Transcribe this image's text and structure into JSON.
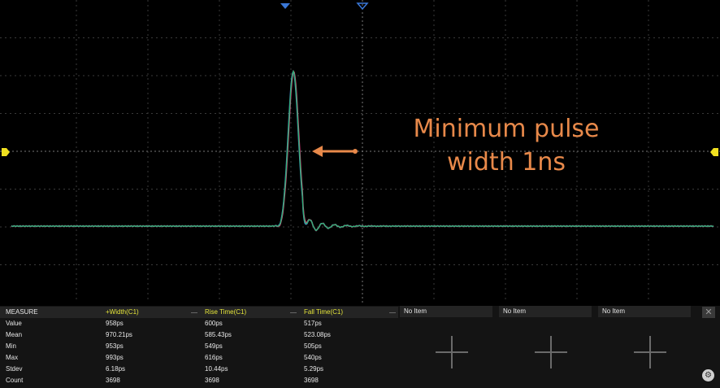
{
  "annotation": {
    "line1": "Minimum pulse",
    "line2": "width 1ns"
  },
  "measure": {
    "header": [
      "MEASURE",
      "+Width(C1)",
      "Rise Time(C1)",
      "Fall Time(C1)"
    ],
    "rows": [
      [
        "Value",
        "958ps",
        "600ps",
        "517ps"
      ],
      [
        "Mean",
        "970.21ps",
        "585.43ps",
        "523.08ps"
      ],
      [
        "Min",
        "953ps",
        "549ps",
        "505ps"
      ],
      [
        "Max",
        "993ps",
        "616ps",
        "540ps"
      ],
      [
        "Stdev",
        "6.18ps",
        "10.44ps",
        "5.29ps"
      ],
      [
        "Count",
        "3698",
        "3698",
        "3698"
      ]
    ],
    "empty_slots": [
      "No Item",
      "No Item",
      "No Item"
    ]
  },
  "colors": {
    "trace_green": "#2fb472",
    "trace_pink": "#d9447e",
    "trace_blue": "#4a7dd8",
    "annotation_orange": "#e8894a",
    "marker_yellow": "#f0e020",
    "header_yellow": "#e6e63a"
  },
  "icons": {
    "close": "close-icon",
    "settings": "gear-icon",
    "add": "plus-icon"
  }
}
